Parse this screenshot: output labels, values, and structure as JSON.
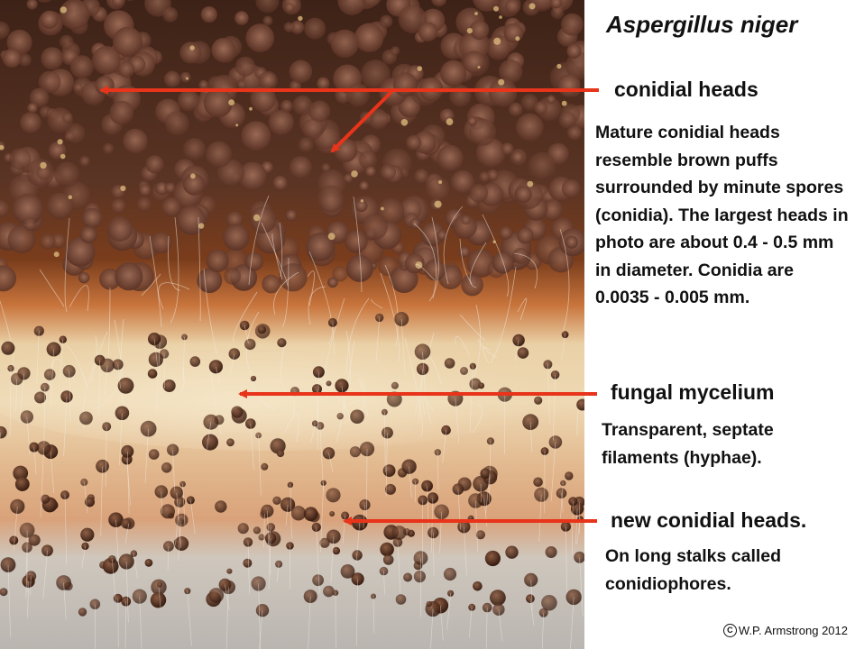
{
  "title": "Aspergillus niger",
  "photo": {
    "description": "Macro photograph of fungal colony with brown conidial heads, pale mycelium and new conidial heads on long stalks"
  },
  "annotations": [
    {
      "label": "conidial heads",
      "description": "Mature conidial heads resemble brown puffs surrounded by minute spores (conidia). The largest heads in photo are about 0.4 - 0.5 mm in diameter. Conidia are 0.0035 - 0.005 mm."
    },
    {
      "label": "fungal mycelium",
      "description": "Transparent, septate filaments (hyphae)."
    },
    {
      "label": "new conidial heads.",
      "description": "On long stalks called conidiophores."
    }
  ],
  "credit": "W.P. Armstrong 2012",
  "colors": {
    "arrow": "#e8341a",
    "text": "#111111"
  }
}
